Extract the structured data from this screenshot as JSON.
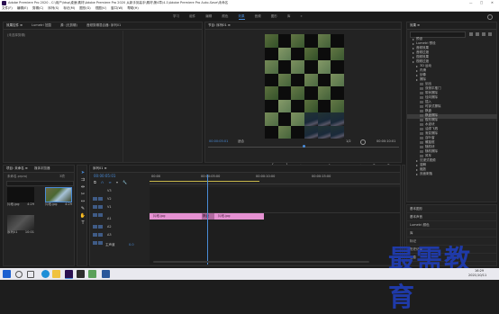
{
  "window": {
    "title": "Adobe Premiere Pro 2020 - C:\\用户\\ldsq\\桌面\\素材\\Adobe Premiere Pro 2020 从新手到高手\\素材\\第4章\\4.1\\Adobe Premiere Pro Auto-Save\\未命名",
    "controls": [
      "—",
      "□",
      "✕"
    ]
  },
  "menu": [
    "文件(F)",
    "编辑(E)",
    "剪辑(C)",
    "序列(S)",
    "标记(M)",
    "图形(G)",
    "视图(V)",
    "窗口(W)",
    "帮助(H)"
  ],
  "workspaces": [
    "学习",
    "组件",
    "编辑",
    "颜色",
    "效果",
    "音频",
    "图形",
    "库",
    "»"
  ],
  "active_workspace": "效果",
  "source_panel": {
    "tabs": [
      "效果控件 ≡",
      "Lumetri 范围",
      "源: (无剪辑)",
      "音频剪辑混合器: 序列01"
    ],
    "empty_label": "(未选择剪辑)"
  },
  "program": {
    "tab": "节目: 序列01 ≡",
    "timecode_left": "00:00:05:01",
    "fit": "适合",
    "quality": "1/2",
    "timecode_right": "00:00:10:01"
  },
  "project": {
    "tab1": "项目: 未命名 ≡",
    "tab2": "媒体浏览器",
    "item_count": "3项",
    "file": "未命名.prproj",
    "items": [
      {
        "label": "片段.jpg",
        "dur": "4:29"
      },
      {
        "label": "片段.jpg",
        "dur": "4:29"
      },
      {
        "label": "序列01",
        "dur": "10:01"
      }
    ]
  },
  "effects": {
    "tab": "效果 ≡",
    "tree": [
      {
        "label": "预设",
        "indent": 1
      },
      {
        "label": "Lumetri 预设",
        "indent": 1
      },
      {
        "label": "音频效果",
        "indent": 1
      },
      {
        "label": "音频过渡",
        "indent": 1
      },
      {
        "label": "视频效果",
        "indent": 1
      },
      {
        "label": "视频过渡",
        "indent": 1
      },
      {
        "label": "3D 运动",
        "indent": 2
      },
      {
        "label": "内滑",
        "indent": 2
      },
      {
        "label": "划像",
        "indent": 2
      },
      {
        "label": "擦除",
        "indent": 2
      },
      {
        "label": "划出",
        "indent": 3
      },
      {
        "label": "双侧平推门",
        "indent": 3
      },
      {
        "label": "带状擦除",
        "indent": 3
      },
      {
        "label": "径向擦除",
        "indent": 3
      },
      {
        "label": "插入",
        "indent": 3
      },
      {
        "label": "时钟式擦除",
        "indent": 3
      },
      {
        "label": "棋盘",
        "indent": 3
      },
      {
        "label": "棋盘擦除",
        "indent": 3,
        "selected": true
      },
      {
        "label": "楔形擦除",
        "indent": 3
      },
      {
        "label": "水波块",
        "indent": 3
      },
      {
        "label": "油漆飞溅",
        "indent": 3
      },
      {
        "label": "渐变擦除",
        "indent": 3
      },
      {
        "label": "百叶窗",
        "indent": 3
      },
      {
        "label": "螺旋框",
        "indent": 3
      },
      {
        "label": "随机块",
        "indent": 3
      },
      {
        "label": "随机擦除",
        "indent": 3
      },
      {
        "label": "风车",
        "indent": 3
      },
      {
        "label": "沉浸式视频",
        "indent": 2
      },
      {
        "label": "溶解",
        "indent": 2
      },
      {
        "label": "缩放",
        "indent": 2
      },
      {
        "label": "页面剥落",
        "indent": 2
      }
    ],
    "bottom_tabs": [
      "基本图形",
      "基本声音",
      "Lumetri 颜色",
      "库",
      "标记",
      "历史记录",
      "信息"
    ]
  },
  "timeline": {
    "tab": "序列01 ≡",
    "timecode": "00:00:05:01",
    "ruler": [
      "00:00",
      "00:00:05:00",
      "00:00:10:00",
      "00:00:15:00"
    ],
    "tracks": [
      "V3",
      "V2",
      "V1",
      "A1",
      "A2",
      "A3",
      "主声道"
    ],
    "master_value": "0.0",
    "clips": [
      {
        "label": "片段.jpg"
      },
      {
        "label": "棋盘"
      },
      {
        "label": "片段.jpg"
      }
    ]
  },
  "taskbar": {
    "time": "16:29",
    "date": "2021/10/11"
  },
  "watermark": "最需教育"
}
